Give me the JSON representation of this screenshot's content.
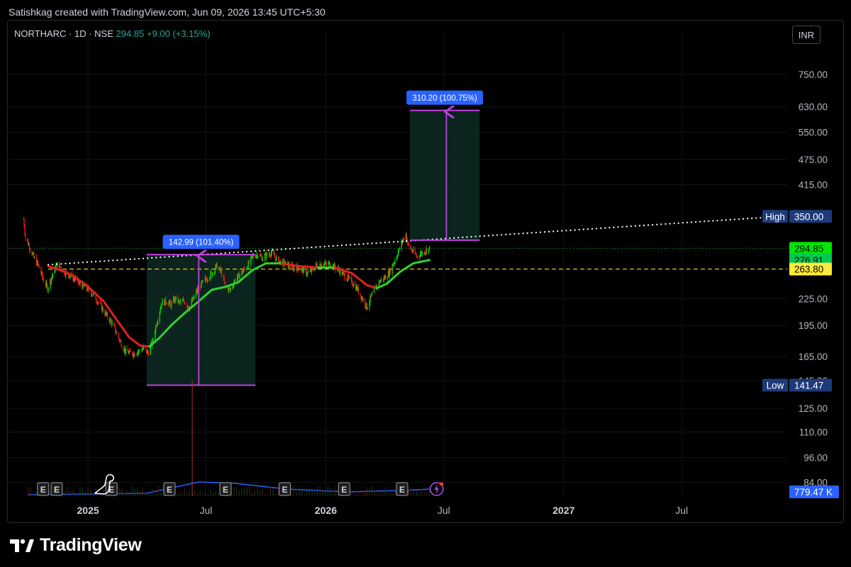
{
  "header_note": "Satishkag created with TradingView.com, Jun 09, 2026 13:45 UTC+5:30",
  "symbol": {
    "name": "NORTHARC · 1D · NSE",
    "price": "294.85",
    "change": "+9.00 (+3.15%)"
  },
  "currency": "INR",
  "brand": "TradingView",
  "colors": {
    "up": "#00e600",
    "down": "#ff1a1a",
    "ma_down": "#e02020",
    "ma_up": "#2fd12f",
    "measure": "#c040e0",
    "box_fill": "#0d2a22",
    "label_bg": "#2962ff",
    "price_tag": "#00e600",
    "ma_tag": "#00c853",
    "level_tag": "#ffeb3b",
    "hl_tag": "#1e3a7a",
    "volume_line": "#2962ff"
  },
  "chart_data": {
    "type": "candlestick",
    "y_scale": "log",
    "ylim": [
      78,
      850
    ],
    "y_ticks": [
      "750.00",
      "630.00",
      "550.00",
      "475.00",
      "415.00",
      "225.00",
      "195.00",
      "165.00",
      "145.00",
      "125.00",
      "110.00",
      "96.00",
      "84.00"
    ],
    "x_ticks": [
      "2025",
      "Jul",
      "2026",
      "Jul",
      "2027",
      "Jul"
    ],
    "x_range": [
      "2024-09-01",
      "2027-12-10"
    ],
    "last_price": "294.85",
    "moving_average": "276.91",
    "horizontal_level": "263.80",
    "high_label": "High",
    "high_value": "350.00",
    "low_label": "Low",
    "low_value": "141.47",
    "volume_value": "779.47 K",
    "price_path": [
      [
        "2024-09-24",
        345
      ],
      [
        "2024-09-27",
        312
      ],
      [
        "2024-10-03",
        298
      ],
      [
        "2024-10-10",
        280
      ],
      [
        "2024-10-17",
        268
      ],
      [
        "2024-10-24",
        250
      ],
      [
        "2024-10-31",
        238
      ],
      [
        "2024-11-07",
        255
      ],
      [
        "2024-11-14",
        270
      ],
      [
        "2024-11-21",
        265
      ],
      [
        "2024-11-28",
        258
      ],
      [
        "2024-12-05",
        255
      ],
      [
        "2024-12-12",
        250
      ],
      [
        "2024-12-19",
        243
      ],
      [
        "2024-12-26",
        240
      ],
      [
        "2025-01-02",
        236
      ],
      [
        "2025-01-09",
        230
      ],
      [
        "2025-01-16",
        222
      ],
      [
        "2025-01-23",
        213
      ],
      [
        "2025-01-30",
        205
      ],
      [
        "2025-02-06",
        198
      ],
      [
        "2025-02-13",
        188
      ],
      [
        "2025-02-20",
        178
      ],
      [
        "2025-02-27",
        170
      ],
      [
        "2025-03-06",
        168
      ],
      [
        "2025-03-13",
        168
      ],
      [
        "2025-03-20",
        170
      ],
      [
        "2025-03-27",
        172
      ],
      [
        "2025-04-03",
        168
      ],
      [
        "2025-04-10",
        178
      ],
      [
        "2025-04-17",
        200
      ],
      [
        "2025-04-24",
        220
      ],
      [
        "2025-05-01",
        222
      ],
      [
        "2025-05-08",
        218
      ],
      [
        "2025-05-15",
        225
      ],
      [
        "2025-05-22",
        220
      ],
      [
        "2025-05-29",
        222
      ],
      [
        "2025-06-05",
        215
      ],
      [
        "2025-06-12",
        225
      ],
      [
        "2025-06-19",
        238
      ],
      [
        "2025-06-26",
        245
      ],
      [
        "2025-07-03",
        252
      ],
      [
        "2025-07-10",
        258
      ],
      [
        "2025-07-17",
        268
      ],
      [
        "2025-07-24",
        260
      ],
      [
        "2025-07-31",
        240
      ],
      [
        "2025-08-07",
        236
      ],
      [
        "2025-08-14",
        248
      ],
      [
        "2025-08-21",
        255
      ],
      [
        "2025-08-28",
        262
      ],
      [
        "2025-09-04",
        270
      ],
      [
        "2025-09-11",
        283
      ],
      [
        "2025-09-18",
        286
      ],
      [
        "2025-09-25",
        280
      ],
      [
        "2025-10-02",
        284
      ],
      [
        "2025-10-09",
        288
      ],
      [
        "2025-10-16",
        280
      ],
      [
        "2025-10-23",
        274
      ],
      [
        "2025-10-30",
        272
      ],
      [
        "2025-11-06",
        268
      ],
      [
        "2025-11-13",
        265
      ],
      [
        "2025-11-20",
        266
      ],
      [
        "2025-11-27",
        262
      ],
      [
        "2025-12-04",
        258
      ],
      [
        "2025-12-11",
        262
      ],
      [
        "2025-12-18",
        270
      ],
      [
        "2025-12-25",
        272
      ],
      [
        "2026-01-01",
        270
      ],
      [
        "2026-01-08",
        272
      ],
      [
        "2026-01-15",
        266
      ],
      [
        "2026-01-22",
        262
      ],
      [
        "2026-01-29",
        255
      ],
      [
        "2026-02-05",
        250
      ],
      [
        "2026-02-12",
        244
      ],
      [
        "2026-02-19",
        236
      ],
      [
        "2026-02-26",
        225
      ],
      [
        "2026-03-05",
        215
      ],
      [
        "2026-03-12",
        228
      ],
      [
        "2026-03-19",
        240
      ],
      [
        "2026-03-26",
        248
      ],
      [
        "2026-04-02",
        252
      ],
      [
        "2026-04-09",
        260
      ],
      [
        "2026-04-16",
        275
      ],
      [
        "2026-04-23",
        292
      ],
      [
        "2026-04-30",
        310
      ],
      [
        "2026-05-04",
        318
      ],
      [
        "2026-05-07",
        300
      ],
      [
        "2026-05-14",
        290
      ],
      [
        "2026-05-21",
        282
      ],
      [
        "2026-05-28",
        288
      ],
      [
        "2026-06-04",
        292
      ],
      [
        "2026-06-09",
        294.85
      ]
    ],
    "ma_path": [
      [
        "2024-11-01",
        268
      ],
      [
        "2024-11-20",
        262
      ],
      [
        "2024-12-10",
        254
      ],
      [
        "2025-01-01",
        240
      ],
      [
        "2025-01-25",
        222
      ],
      [
        "2025-02-15",
        200
      ],
      [
        "2025-03-05",
        183
      ],
      [
        "2025-03-22",
        175
      ],
      [
        "2025-04-05",
        174
      ],
      [
        "2025-04-20",
        182
      ],
      [
        "2025-05-10",
        196
      ],
      [
        "2025-06-01",
        210
      ],
      [
        "2025-06-20",
        222
      ],
      [
        "2025-07-10",
        236
      ],
      [
        "2025-08-01",
        240
      ],
      [
        "2025-08-20",
        246
      ],
      [
        "2025-09-10",
        262
      ],
      [
        "2025-10-01",
        272
      ],
      [
        "2025-10-25",
        272
      ],
      [
        "2025-11-20",
        268
      ],
      [
        "2025-12-20",
        266
      ],
      [
        "2026-01-15",
        266
      ],
      [
        "2026-02-10",
        258
      ],
      [
        "2026-03-05",
        242
      ],
      [
        "2026-03-20",
        238
      ],
      [
        "2026-04-05",
        244
      ],
      [
        "2026-04-25",
        260
      ],
      [
        "2026-05-15",
        272
      ],
      [
        "2026-06-09",
        276.91
      ]
    ],
    "trendline": {
      "from": [
        "2024-11-01",
        270
      ],
      "to": [
        "2027-11-30",
        350
      ]
    },
    "measures": [
      {
        "label": "142.99 (101.40%)",
        "from_date": "2025-04-01",
        "to_date": "2025-09-15",
        "low": 141.47,
        "high": 285,
        "arrow_date": "2025-06-20"
      },
      {
        "label": "310.20 (100.75%)",
        "from_date": "2026-05-10",
        "to_date": "2026-08-25",
        "low": 308,
        "high": 618,
        "arrow_date": "2026-07-05"
      }
    ],
    "earnings_marks": [
      "2024-10-24",
      "2024-11-14",
      "2025-02-06",
      "2025-05-06",
      "2025-07-31",
      "2025-10-30",
      "2026-01-29",
      "2026-04-28"
    ],
    "earnings_label": "E",
    "volume_spike_date": "2025-06-10"
  }
}
